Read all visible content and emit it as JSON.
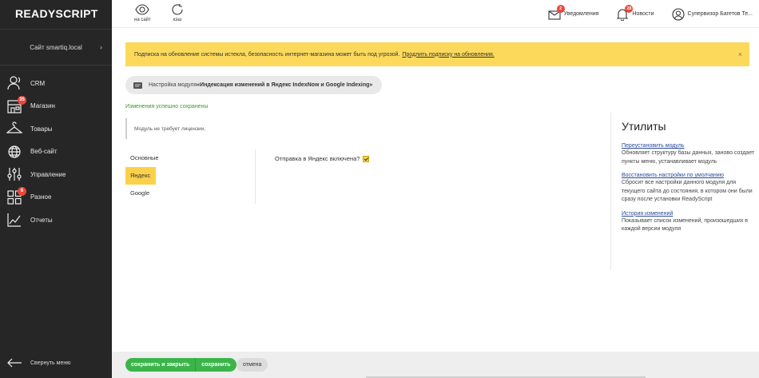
{
  "sidebar": {
    "logo": "READYSCRIPT",
    "site": "Сайт smartiq.local",
    "items": [
      {
        "label": "CRM",
        "icon": "crm-icon"
      },
      {
        "label": "Магазин",
        "icon": "shop-icon",
        "badge": "35"
      },
      {
        "label": "Товары",
        "icon": "hanger-icon"
      },
      {
        "label": "Веб-сайт",
        "icon": "globe-icon"
      },
      {
        "label": "Управление",
        "icon": "sliders-icon"
      },
      {
        "label": "Разное",
        "icon": "grid-icon",
        "badge": "6"
      },
      {
        "label": "Отчеты",
        "icon": "chart-icon"
      }
    ],
    "collapse_label": "Свернуть меню"
  },
  "topbar": {
    "view_site": "на сайт",
    "cache": "кэш",
    "notifications": {
      "label": "Уведомления",
      "badge": "2"
    },
    "news": {
      "label": "Новости",
      "badge": "28"
    },
    "user": "Супервизор Багетов Те..."
  },
  "notice": {
    "text": "Подписка на обновление системы истекла, безопасность интернет-магазина может быть под угрозой.",
    "link": "Продлить подписку на обновления.",
    "close": "×"
  },
  "module": {
    "prefix": "Настройка модуля ",
    "name": "«Индексация изменений в Яндекс IndexNow и Google Indexing»"
  },
  "success_message": "Изменения успешно сохранены",
  "license_message": "Модуль не требует лицензии.",
  "tabs": [
    {
      "label": "Основные",
      "active": false
    },
    {
      "label": "Яндекс",
      "active": true
    },
    {
      "label": "Google",
      "active": false
    }
  ],
  "field": {
    "label": "Отправка в Яндекс включена?",
    "checked": true
  },
  "utilities": {
    "title": "Утилиты",
    "items": [
      {
        "link": "Переустановить модуль",
        "desc": "Обновляет структуру базы данных, заново создает пункты меню, устанавливает модуль"
      },
      {
        "link": "Восстановить настройки по умолчанию",
        "desc": "Сбросит все настройки данного модуля для текущего сайта до состояния, в котором они были сразу после установки ReadyScript"
      },
      {
        "link": "История изменений",
        "desc": "Показывает список изменений, произошедших в каждой версии модуля"
      }
    ]
  },
  "buttons": {
    "save_close": "сохранить и закрыть",
    "save": "сохранить",
    "cancel": "отмена"
  }
}
